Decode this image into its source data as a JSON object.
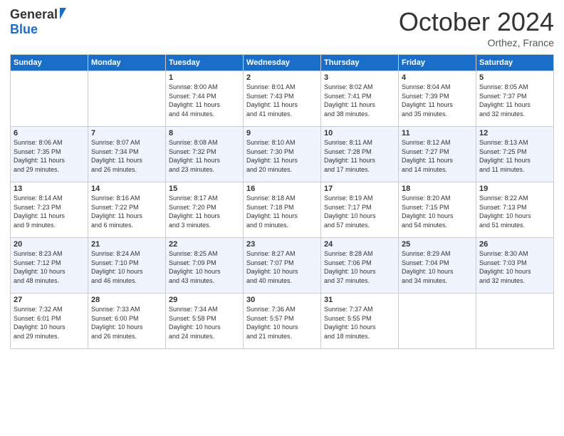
{
  "logo": {
    "general": "General",
    "blue": "Blue"
  },
  "title": "October 2024",
  "location": "Orthez, France",
  "days_header": [
    "Sunday",
    "Monday",
    "Tuesday",
    "Wednesday",
    "Thursday",
    "Friday",
    "Saturday"
  ],
  "weeks": [
    [
      {
        "num": "",
        "info": ""
      },
      {
        "num": "",
        "info": ""
      },
      {
        "num": "1",
        "info": "Sunrise: 8:00 AM\nSunset: 7:44 PM\nDaylight: 11 hours\nand 44 minutes."
      },
      {
        "num": "2",
        "info": "Sunrise: 8:01 AM\nSunset: 7:43 PM\nDaylight: 11 hours\nand 41 minutes."
      },
      {
        "num": "3",
        "info": "Sunrise: 8:02 AM\nSunset: 7:41 PM\nDaylight: 11 hours\nand 38 minutes."
      },
      {
        "num": "4",
        "info": "Sunrise: 8:04 AM\nSunset: 7:39 PM\nDaylight: 11 hours\nand 35 minutes."
      },
      {
        "num": "5",
        "info": "Sunrise: 8:05 AM\nSunset: 7:37 PM\nDaylight: 11 hours\nand 32 minutes."
      }
    ],
    [
      {
        "num": "6",
        "info": "Sunrise: 8:06 AM\nSunset: 7:35 PM\nDaylight: 11 hours\nand 29 minutes."
      },
      {
        "num": "7",
        "info": "Sunrise: 8:07 AM\nSunset: 7:34 PM\nDaylight: 11 hours\nand 26 minutes."
      },
      {
        "num": "8",
        "info": "Sunrise: 8:08 AM\nSunset: 7:32 PM\nDaylight: 11 hours\nand 23 minutes."
      },
      {
        "num": "9",
        "info": "Sunrise: 8:10 AM\nSunset: 7:30 PM\nDaylight: 11 hours\nand 20 minutes."
      },
      {
        "num": "10",
        "info": "Sunrise: 8:11 AM\nSunset: 7:28 PM\nDaylight: 11 hours\nand 17 minutes."
      },
      {
        "num": "11",
        "info": "Sunrise: 8:12 AM\nSunset: 7:27 PM\nDaylight: 11 hours\nand 14 minutes."
      },
      {
        "num": "12",
        "info": "Sunrise: 8:13 AM\nSunset: 7:25 PM\nDaylight: 11 hours\nand 11 minutes."
      }
    ],
    [
      {
        "num": "13",
        "info": "Sunrise: 8:14 AM\nSunset: 7:23 PM\nDaylight: 11 hours\nand 9 minutes."
      },
      {
        "num": "14",
        "info": "Sunrise: 8:16 AM\nSunset: 7:22 PM\nDaylight: 11 hours\nand 6 minutes."
      },
      {
        "num": "15",
        "info": "Sunrise: 8:17 AM\nSunset: 7:20 PM\nDaylight: 11 hours\nand 3 minutes."
      },
      {
        "num": "16",
        "info": "Sunrise: 8:18 AM\nSunset: 7:18 PM\nDaylight: 11 hours\nand 0 minutes."
      },
      {
        "num": "17",
        "info": "Sunrise: 8:19 AM\nSunset: 7:17 PM\nDaylight: 10 hours\nand 57 minutes."
      },
      {
        "num": "18",
        "info": "Sunrise: 8:20 AM\nSunset: 7:15 PM\nDaylight: 10 hours\nand 54 minutes."
      },
      {
        "num": "19",
        "info": "Sunrise: 8:22 AM\nSunset: 7:13 PM\nDaylight: 10 hours\nand 51 minutes."
      }
    ],
    [
      {
        "num": "20",
        "info": "Sunrise: 8:23 AM\nSunset: 7:12 PM\nDaylight: 10 hours\nand 48 minutes."
      },
      {
        "num": "21",
        "info": "Sunrise: 8:24 AM\nSunset: 7:10 PM\nDaylight: 10 hours\nand 46 minutes."
      },
      {
        "num": "22",
        "info": "Sunrise: 8:25 AM\nSunset: 7:09 PM\nDaylight: 10 hours\nand 43 minutes."
      },
      {
        "num": "23",
        "info": "Sunrise: 8:27 AM\nSunset: 7:07 PM\nDaylight: 10 hours\nand 40 minutes."
      },
      {
        "num": "24",
        "info": "Sunrise: 8:28 AM\nSunset: 7:06 PM\nDaylight: 10 hours\nand 37 minutes."
      },
      {
        "num": "25",
        "info": "Sunrise: 8:29 AM\nSunset: 7:04 PM\nDaylight: 10 hours\nand 34 minutes."
      },
      {
        "num": "26",
        "info": "Sunrise: 8:30 AM\nSunset: 7:03 PM\nDaylight: 10 hours\nand 32 minutes."
      }
    ],
    [
      {
        "num": "27",
        "info": "Sunrise: 7:32 AM\nSunset: 6:01 PM\nDaylight: 10 hours\nand 29 minutes."
      },
      {
        "num": "28",
        "info": "Sunrise: 7:33 AM\nSunset: 6:00 PM\nDaylight: 10 hours\nand 26 minutes."
      },
      {
        "num": "29",
        "info": "Sunrise: 7:34 AM\nSunset: 5:58 PM\nDaylight: 10 hours\nand 24 minutes."
      },
      {
        "num": "30",
        "info": "Sunrise: 7:36 AM\nSunset: 5:57 PM\nDaylight: 10 hours\nand 21 minutes."
      },
      {
        "num": "31",
        "info": "Sunrise: 7:37 AM\nSunset: 5:55 PM\nDaylight: 10 hours\nand 18 minutes."
      },
      {
        "num": "",
        "info": ""
      },
      {
        "num": "",
        "info": ""
      }
    ]
  ]
}
